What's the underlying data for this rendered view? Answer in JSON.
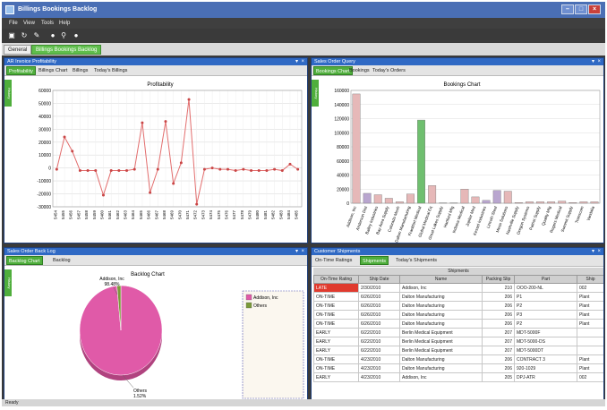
{
  "window": {
    "title": "Billings Bookings Backlog"
  },
  "menu": [
    "File",
    "View",
    "Tools",
    "Help"
  ],
  "toolbar_icons": [
    "new-icon",
    "refresh-icon",
    "edit-icon",
    "comment-icon",
    "search-icon",
    "help-icon"
  ],
  "main_tabs": [
    {
      "label": "General",
      "active": false
    },
    {
      "label": "Billings Bookings Backlog",
      "active": true
    }
  ],
  "panels": {
    "tl": {
      "title": "AR Invoice Profitability",
      "tabs": [
        "Profitability",
        "Billings Chart",
        "Billings",
        "Today's Billings"
      ],
      "side": "History"
    },
    "tr": {
      "title": "Sales Order Query",
      "tabs": [
        "Bookings Chart",
        "Bookings",
        "Today's Orders"
      ],
      "side": "History"
    },
    "bl": {
      "title": "Sales Order Back Log",
      "tabs": [
        "Backlog Chart",
        "Backlog"
      ],
      "side": "History"
    },
    "br": {
      "title": "Customer Shipments",
      "tabs": [
        "On-Time Ratings",
        "Shipments",
        "Today's Shipments"
      ],
      "grid_title": "Shipments",
      "columns": [
        "On-Time Rating",
        "Ship Date",
        "Name",
        "Packing Slip",
        "Part",
        "Ship"
      ],
      "rows": [
        [
          "LATE",
          "2/30/2010",
          "Addison, Inc",
          "210",
          "OOO-200-NL",
          "002"
        ],
        [
          "ON-TIME",
          "6/26/2010",
          "Dalton Manufacturing",
          "206",
          "P1",
          "Plant"
        ],
        [
          "ON-TIME",
          "6/26/2010",
          "Dalton Manufacturing",
          "206",
          "P2",
          "Plant"
        ],
        [
          "ON-TIME",
          "6/26/2010",
          "Dalton Manufacturing",
          "206",
          "P3",
          "Plant"
        ],
        [
          "ON-TIME",
          "6/26/2010",
          "Dalton Manufacturing",
          "206",
          "P2",
          "Plant"
        ],
        [
          "EARLY",
          "6/22/2010",
          "Berlin Medical Equipment",
          "207",
          "MDT-5000F",
          ""
        ],
        [
          "EARLY",
          "6/22/2010",
          "Berlin Medical Equipment",
          "207",
          "MDT-5000-DS",
          ""
        ],
        [
          "EARLY",
          "6/22/2010",
          "Berlin Medical Equipment",
          "207",
          "MDT-5000DT",
          ""
        ],
        [
          "ON-TIME",
          "4/23/2010",
          "Dalton Manufacturing",
          "206",
          "CONTRACT 3",
          "Plant"
        ],
        [
          "ON-TIME",
          "4/23/2010",
          "Dalton Manufacturing",
          "206",
          "920-1029",
          "Plant"
        ],
        [
          "EARLY",
          "4/23/2010",
          "Addison, Inc",
          "205",
          "DPJ-ATR",
          "002"
        ]
      ]
    }
  },
  "status": "Ready",
  "chart_data": [
    {
      "type": "line",
      "title": "Profitability",
      "ylim": [
        -30000,
        60000
      ],
      "yticks": [
        -30000,
        -20000,
        -10000,
        0,
        10000,
        20000,
        30000,
        40000,
        50000,
        60000
      ],
      "x": [
        "5454",
        "5455",
        "5456",
        "5457",
        "5458",
        "5459",
        "5460",
        "5461",
        "5462",
        "5463",
        "5464",
        "5465",
        "5466",
        "5467",
        "5468",
        "5469",
        "5470",
        "5471",
        "5472",
        "5473",
        "5474",
        "5475",
        "5476",
        "5477",
        "5478",
        "5479",
        "5480",
        "5481",
        "5482",
        "5483",
        "5484",
        "5485"
      ],
      "values": [
        -1000,
        24000,
        13000,
        -2000,
        -2000,
        -2000,
        -21000,
        -2000,
        -2000,
        -2000,
        -1000,
        35000,
        -19000,
        -1000,
        36000,
        -12000,
        4000,
        53000,
        -28000,
        -1000,
        0,
        -1000,
        -1000,
        -2000,
        -1000,
        -2000,
        -2000,
        -2000,
        -1000,
        -2000,
        3000,
        -1000
      ],
      "grid": true,
      "color": "#e26d6d"
    },
    {
      "type": "bar",
      "title": "Bookings Chart",
      "ylim": [
        0,
        160000
      ],
      "yticks": [
        0,
        20000,
        40000,
        60000,
        80000,
        100000,
        120000,
        140000,
        160000
      ],
      "categories": [
        "Addison, Inc",
        "Anderson Dist",
        "Bailey Industries",
        "Bay Area Supply",
        "Colorado Mech",
        "Dalton Manufacturing",
        "Frankfort Medical",
        "Global Medical Eq",
        "Great Lakes Supply",
        "Hartford Mfg",
        "Indiana Medical",
        "Jupiter Med",
        "Kessel Industries",
        "Lincoln Steel",
        "Mesa Solutions",
        "Nashville Supply",
        "Oregon Systems",
        "Patriot Supply",
        "Quality Mfg",
        "Rogers Medical",
        "Summit Supply",
        "Transcom",
        "Vandalia"
      ],
      "values": [
        155000,
        14000,
        12000,
        7000,
        2000,
        13000,
        118000,
        25000,
        500,
        500,
        20000,
        9000,
        4000,
        18000,
        17000,
        1000,
        2000,
        2000,
        2000,
        3000,
        1000,
        2000,
        2000
      ],
      "highlight": 6,
      "colors": {
        "default": "#e6b8b8",
        "highlight": "#6fbf6f",
        "accent": "#b9a6cf"
      },
      "grid": true
    },
    {
      "type": "pie",
      "title": "Backlog Chart",
      "slices": [
        {
          "label": "Addison, Inc",
          "percent": 98.48,
          "color": "#e05aa8"
        },
        {
          "label": "Others",
          "percent": 1.52,
          "color": "#7a9a3a"
        }
      ],
      "slice_labels": [
        "Addison, Inc\n98.48%",
        "Others\n1.52%"
      ],
      "legend": [
        "Addison, Inc",
        "Others"
      ]
    }
  ]
}
